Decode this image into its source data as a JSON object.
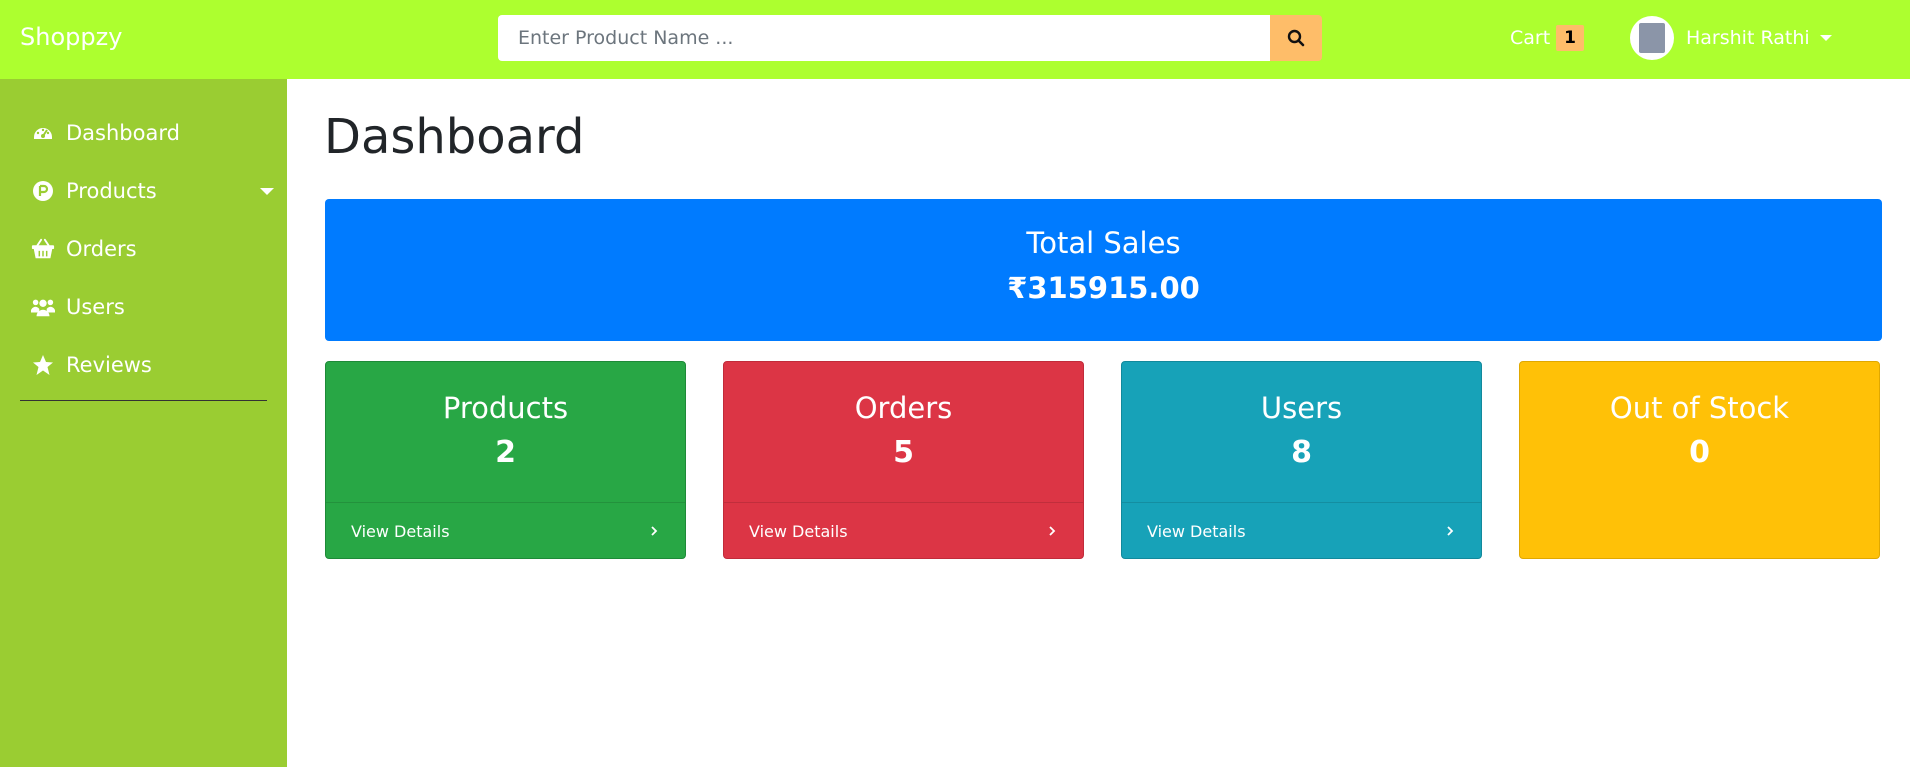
{
  "app": {
    "brand": "Shoppzy"
  },
  "search": {
    "placeholder": "Enter Product Name ..."
  },
  "header": {
    "cart_label": "Cart",
    "cart_count": "1",
    "user_name": "Harshit Rathi"
  },
  "sidebar": {
    "items": [
      {
        "label": "Dashboard",
        "icon": "tachometer-icon"
      },
      {
        "label": "Products",
        "icon": "product-p-icon"
      },
      {
        "label": "Orders",
        "icon": "basket-icon"
      },
      {
        "label": "Users",
        "icon": "users-icon"
      },
      {
        "label": "Reviews",
        "icon": "star-icon"
      }
    ]
  },
  "main": {
    "title": "Dashboard",
    "total_sales": {
      "label": "Total Sales",
      "value": "₹315915.00"
    },
    "cards": [
      {
        "label": "Products",
        "value": "2",
        "link": "View Details",
        "color": "#28a745"
      },
      {
        "label": "Orders",
        "value": "5",
        "link": "View Details",
        "color": "#dc3545"
      },
      {
        "label": "Users",
        "value": "8",
        "link": "View Details",
        "color": "#17a2b8"
      },
      {
        "label": "Out of Stock",
        "value": "0",
        "color": "#ffc107"
      }
    ]
  },
  "colors": {
    "topbar": "#adff2f",
    "sidebar": "#9acd32",
    "search_button": "#febd69",
    "total_sales": "#007bff"
  }
}
